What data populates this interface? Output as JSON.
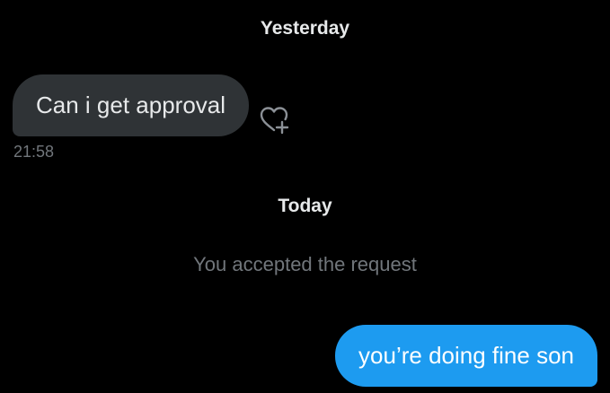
{
  "conversation": {
    "separators": {
      "yesterday": "Yesterday",
      "today": "Today"
    },
    "incoming": {
      "text": "Can i get approval",
      "time": "21:58",
      "reaction_icon": "heart-plus-icon"
    },
    "system_message": "You accepted the request",
    "outgoing": {
      "text": "you’re doing fine son"
    }
  },
  "colors": {
    "background": "#000000",
    "incoming_bubble": "#2f3336",
    "outgoing_bubble": "#1d9bf0",
    "muted_text": "#71767b",
    "primary_text": "#e7e9ea"
  }
}
